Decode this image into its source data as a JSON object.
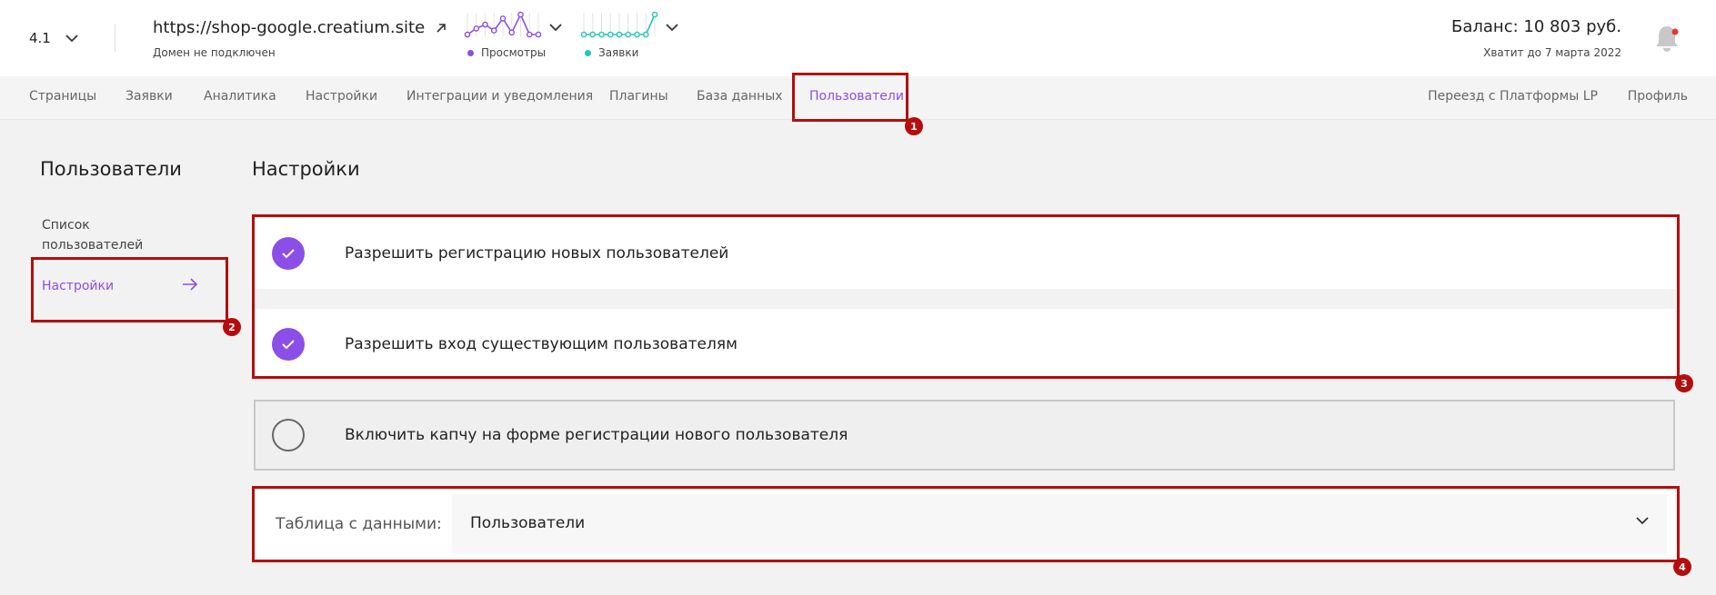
{
  "header": {
    "version": "4.1",
    "site_url": "https://shop-google.creatium.site",
    "domain_status": "Домен не подключен",
    "views_label": "Просмотры",
    "leads_label": "Заявки",
    "balance": "Баланс: 10 803 руб.",
    "balance_note": "Хватит до 7 марта 2022",
    "colors": {
      "views": "#8b4fe8",
      "leads": "#1fc7b7",
      "notification": "#e53935"
    },
    "views_trend": [
      3,
      6,
      8,
      5,
      11,
      4,
      13,
      3,
      3
    ],
    "leads_trend": [
      2,
      2,
      2,
      2,
      2,
      2,
      2,
      2,
      12
    ]
  },
  "nav": {
    "items": [
      "Страницы",
      "Заявки",
      "Аналитика",
      "Настройки",
      "Интеграции и уведомления",
      "Плагины",
      "База данных",
      "Пользователи"
    ],
    "active_index": 7,
    "right_items": [
      "Переезд с Платформы LP",
      "Профиль"
    ]
  },
  "sidebar": {
    "title": "Пользователи",
    "items": [
      {
        "label": "Список пользователей"
      },
      {
        "label": "Настройки"
      }
    ]
  },
  "main": {
    "title": "Настройки",
    "options": [
      {
        "label": "Разрешить регистрацию новых пользователей",
        "checked": true
      },
      {
        "label": "Разрешить вход существующим пользователям",
        "checked": true
      },
      {
        "label": "Включить капчу на форме регистрации нового пользователя",
        "checked": false
      }
    ],
    "table": {
      "label": "Таблица с данными:",
      "value": "Пользователи"
    }
  },
  "annotations": [
    "1",
    "2",
    "3",
    "4"
  ],
  "accent_color": "#8b4fe8",
  "highlight_color": "#b50d0d"
}
